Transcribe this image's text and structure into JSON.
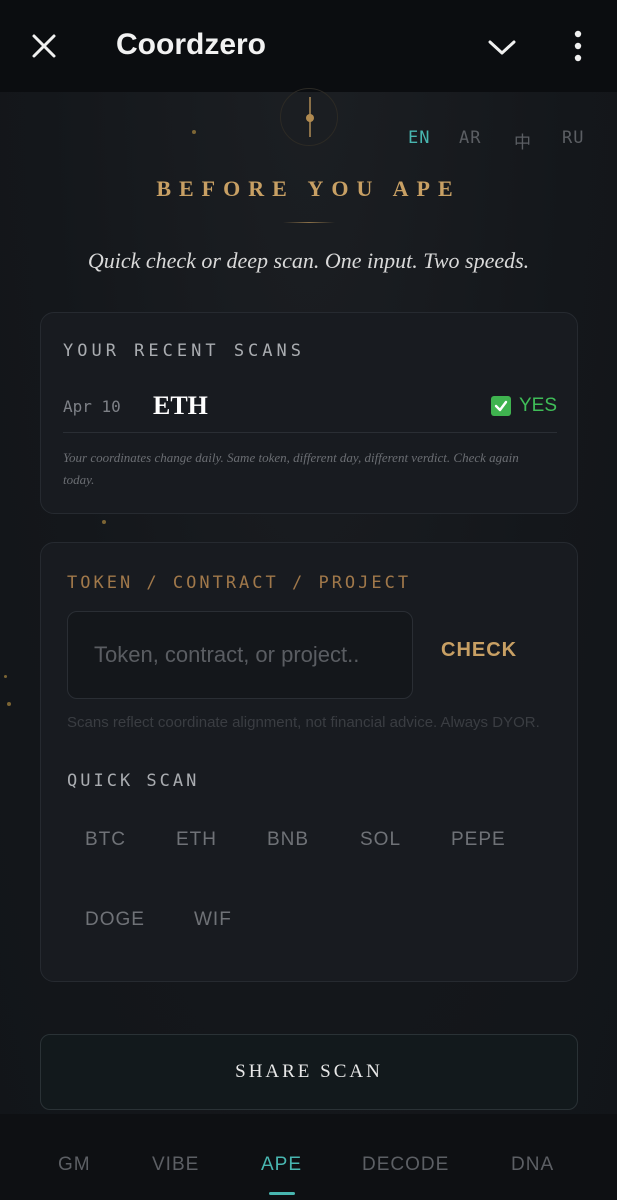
{
  "app": {
    "title": "Coordzero"
  },
  "languages": [
    "EN",
    "AR",
    "中",
    "RU"
  ],
  "hero": {
    "title": "BEFORE YOU APE",
    "subtitle": "Quick check or deep scan. One input. Two speeds."
  },
  "recent": {
    "heading": "YOUR RECENT SCANS",
    "scans": [
      {
        "date": "Apr 10",
        "token": "ETH",
        "verdict": "YES"
      }
    ],
    "note": "Your coordinates change daily. Same token, different day, different verdict. Check again today."
  },
  "scanner": {
    "label": "TOKEN / CONTRACT / PROJECT",
    "placeholder": "Token, contract, or project..",
    "check_label": "CHECK",
    "disclaimer": "Scans reflect coordinate alignment, not financial advice. Always DYOR.",
    "quick_label": "QUICK SCAN",
    "chips": [
      "BTC",
      "ETH",
      "BNB",
      "SOL",
      "PEPE",
      "DOGE",
      "WIF"
    ]
  },
  "share_label": "SHARE SCAN",
  "nav": [
    "GM",
    "VIBE",
    "APE",
    "DECODE",
    "DNA"
  ],
  "colors": {
    "accent_teal": "#48b6b0",
    "accent_gold": "#c8a064",
    "verdict_green": "#3fbd58"
  },
  "icons": {
    "close": "close-icon",
    "chevron": "chevron-down-icon",
    "more": "more-vert-icon",
    "emblem": "sundial-icon",
    "verdict": "check-box-icon"
  }
}
